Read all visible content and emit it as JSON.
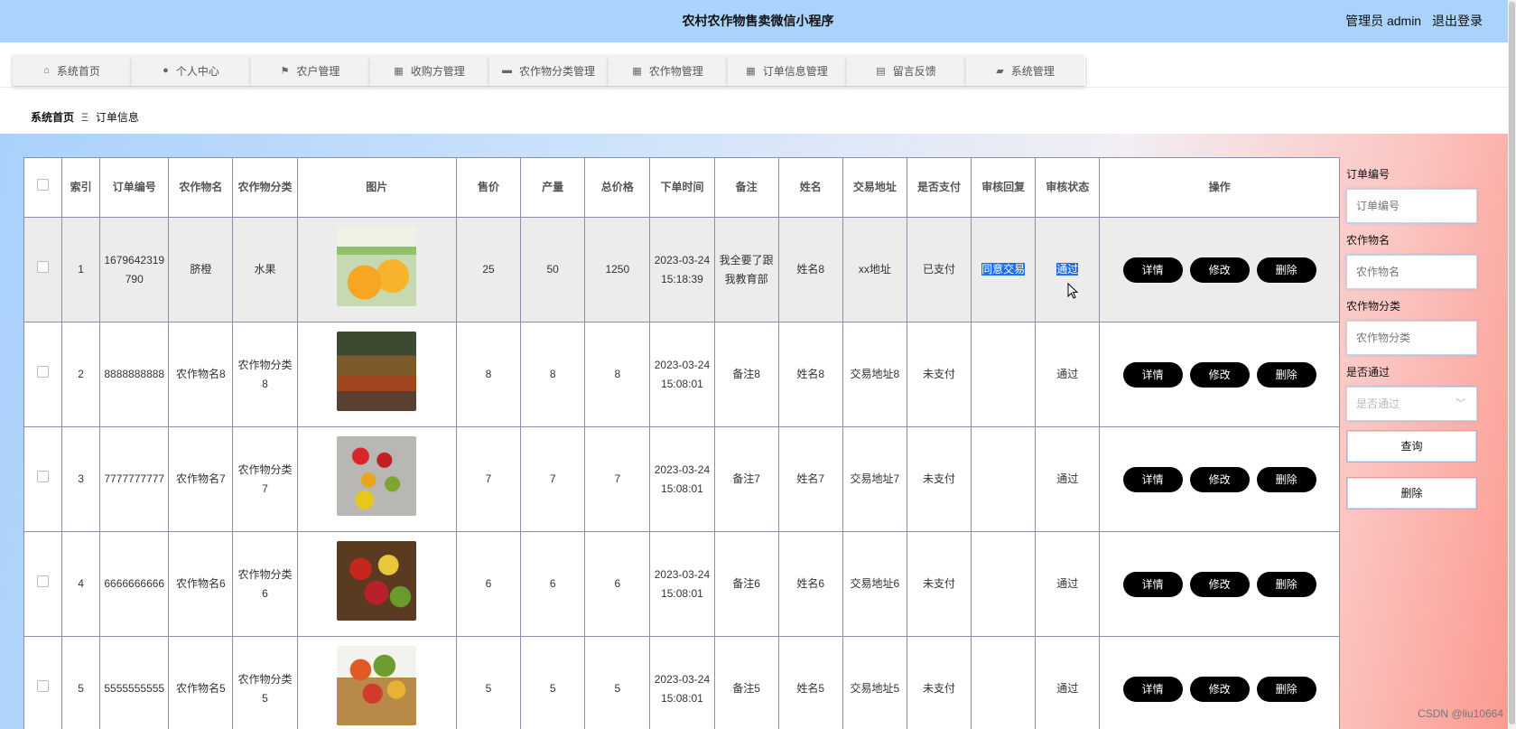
{
  "header": {
    "title": "农村农作物售卖微信小程序",
    "user": "管理员 admin",
    "logout": "退出登录"
  },
  "nav": [
    {
      "label": "系统首页",
      "icon": "⌂"
    },
    {
      "label": "个人中心",
      "icon": "●"
    },
    {
      "label": "农户管理",
      "icon": "⚑"
    },
    {
      "label": "收购方管理",
      "icon": "▦"
    },
    {
      "label": "农作物分类管理",
      "icon": "▬"
    },
    {
      "label": "农作物管理",
      "icon": "▦"
    },
    {
      "label": "订单信息管理",
      "icon": "▦"
    },
    {
      "label": "留言反馈",
      "icon": "▤"
    },
    {
      "label": "系统管理",
      "icon": "▰"
    }
  ],
  "breadcrumb": {
    "home": "系统首页",
    "sep": "Ξ",
    "current": "订单信息"
  },
  "table": {
    "headers": [
      "索引",
      "订单编号",
      "农作物名",
      "农作物分类",
      "图片",
      "售价",
      "产量",
      "总价格",
      "下单时间",
      "备注",
      "姓名",
      "交易地址",
      "是否支付",
      "审核回复",
      "审核状态",
      "操作"
    ],
    "rows": [
      {
        "index": "1",
        "order_no": "1679642319790",
        "name": "脐橙",
        "category": "水果",
        "price": "25",
        "qty": "50",
        "total": "1250",
        "time": "2023-03-24 15:18:39",
        "note": "我全要了跟我教育部",
        "person": "姓名8",
        "address": "xx地址",
        "paid": "已支付",
        "reply": "同意交易",
        "status": "通过"
      },
      {
        "index": "2",
        "order_no": "8888888888",
        "name": "农作物名8",
        "category": "农作物分类8",
        "price": "8",
        "qty": "8",
        "total": "8",
        "time": "2023-03-24 15:08:01",
        "note": "备注8",
        "person": "姓名8",
        "address": "交易地址8",
        "paid": "未支付",
        "reply": "",
        "status": "通过"
      },
      {
        "index": "3",
        "order_no": "7777777777",
        "name": "农作物名7",
        "category": "农作物分类7",
        "price": "7",
        "qty": "7",
        "total": "7",
        "time": "2023-03-24 15:08:01",
        "note": "备注7",
        "person": "姓名7",
        "address": "交易地址7",
        "paid": "未支付",
        "reply": "",
        "status": "通过"
      },
      {
        "index": "4",
        "order_no": "6666666666",
        "name": "农作物名6",
        "category": "农作物分类6",
        "price": "6",
        "qty": "6",
        "total": "6",
        "time": "2023-03-24 15:08:01",
        "note": "备注6",
        "person": "姓名6",
        "address": "交易地址6",
        "paid": "未支付",
        "reply": "",
        "status": "通过"
      },
      {
        "index": "5",
        "order_no": "5555555555",
        "name": "农作物名5",
        "category": "农作物分类5",
        "price": "5",
        "qty": "5",
        "total": "5",
        "time": "2023-03-24 15:08:01",
        "note": "备注5",
        "person": "姓名5",
        "address": "交易地址5",
        "paid": "未支付",
        "reply": "",
        "status": "通过"
      }
    ],
    "actions": {
      "detail": "详情",
      "edit": "修改",
      "delete": "删除"
    }
  },
  "search": {
    "order_no_label": "订单编号",
    "order_no_placeholder": "订单编号",
    "crop_name_label": "农作物名",
    "crop_name_placeholder": "农作物名",
    "crop_cat_label": "农作物分类",
    "crop_cat_placeholder": "农作物分类",
    "approved_label": "是否通过",
    "approved_placeholder": "是否通过",
    "query_button": "查询",
    "delete_button": "删除"
  },
  "watermark": "CSDN @liu10664",
  "colors": {
    "header": "#a9d3fb",
    "accent": "#1e6ff0",
    "button": "#000000"
  }
}
